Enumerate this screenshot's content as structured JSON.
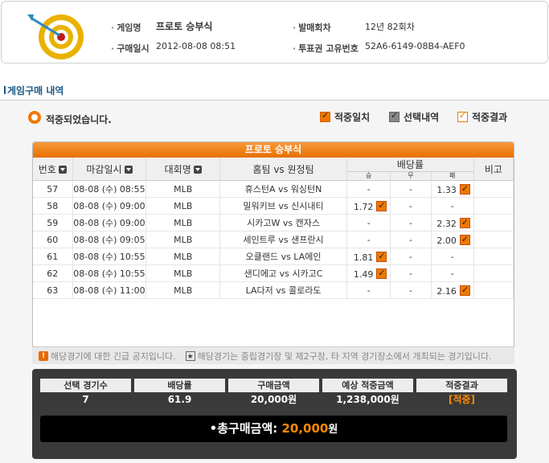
{
  "header": {
    "game_name_label": "게임명",
    "game_name": "프로토 승부식",
    "issue_round_label": "발매회차",
    "issue_round": "12년 82회차",
    "purchase_date_label": "구매일시",
    "purchase_date": "2012-08-08 08:51",
    "ticket_id_label": "투표권 고유번호",
    "ticket_id": "52A6-6149-08B4-AEF0"
  },
  "section_title": "게임구매 내역",
  "status_text": "적중되었습니다.",
  "legend": [
    {
      "label": "적중일치",
      "style": "orange"
    },
    {
      "label": "선택내역",
      "style": "gray"
    },
    {
      "label": "적중결과",
      "style": "outline"
    }
  ],
  "table": {
    "title": "프로토 승부식",
    "headers": {
      "no": "번호",
      "deadline": "마감일시",
      "league": "대회명",
      "match": "홈팀 vs 원정팀",
      "odds": "배당률",
      "odds_win": "승",
      "odds_draw": "무",
      "odds_lose": "패",
      "note": "비고"
    },
    "rows": [
      {
        "no": "57",
        "deadline": "08-08 (수) 08:55",
        "league": "MLB",
        "match": "휴스턴A vs 워싱턴N",
        "win": "-",
        "draw": "-",
        "lose": "1.33",
        "pick": "lose"
      },
      {
        "no": "58",
        "deadline": "08-08 (수) 09:00",
        "league": "MLB",
        "match": "밀워키브 vs 신시내티",
        "win": "1.72",
        "draw": "-",
        "lose": "-",
        "pick": "win"
      },
      {
        "no": "59",
        "deadline": "08-08 (수) 09:00",
        "league": "MLB",
        "match": "시카고W vs 캔자스",
        "win": "-",
        "draw": "-",
        "lose": "2.32",
        "pick": "lose"
      },
      {
        "no": "60",
        "deadline": "08-08 (수) 09:05",
        "league": "MLB",
        "match": "세인트루 vs 샌프란시",
        "win": "-",
        "draw": "-",
        "lose": "2.00",
        "pick": "lose"
      },
      {
        "no": "61",
        "deadline": "08-08 (수) 10:55",
        "league": "MLB",
        "match": "오클랜드 vs LA에인",
        "win": "1.81",
        "draw": "-",
        "lose": "-",
        "pick": "win"
      },
      {
        "no": "62",
        "deadline": "08-08 (수) 10:55",
        "league": "MLB",
        "match": "샌디에고 vs 시카고C",
        "win": "1.49",
        "draw": "-",
        "lose": "-",
        "pick": "win"
      },
      {
        "no": "63",
        "deadline": "08-08 (수) 11:00",
        "league": "MLB",
        "match": "LA다저 vs 콜로라도",
        "win": "-",
        "draw": "-",
        "lose": "2.16",
        "pick": "lose"
      }
    ]
  },
  "notices": {
    "urgent": "해당경기에 대한 긴급 공지입니다.",
    "venue": "해당경기는 중립경기장 및 제2구장, 타 지역 경기장소에서 개최되는 경기입니다."
  },
  "summary": {
    "selected_games_label": "선택 경기수",
    "selected_games": "7",
    "odds_label": "배당률",
    "odds": "61.9",
    "purchase_amount_label": "구매금액",
    "purchase_amount": "20,000원",
    "expected_win_label": "예상 적중금액",
    "expected_win": "1,238,000원",
    "result_label": "적중결과",
    "result": "[적중]",
    "total_label": "•총구매금액:",
    "total_amount": "20,000",
    "total_unit": "원"
  },
  "colors": {
    "accent": "#f07800",
    "dark": "#3a3a3a",
    "title_blue": "#1a5a8a"
  }
}
